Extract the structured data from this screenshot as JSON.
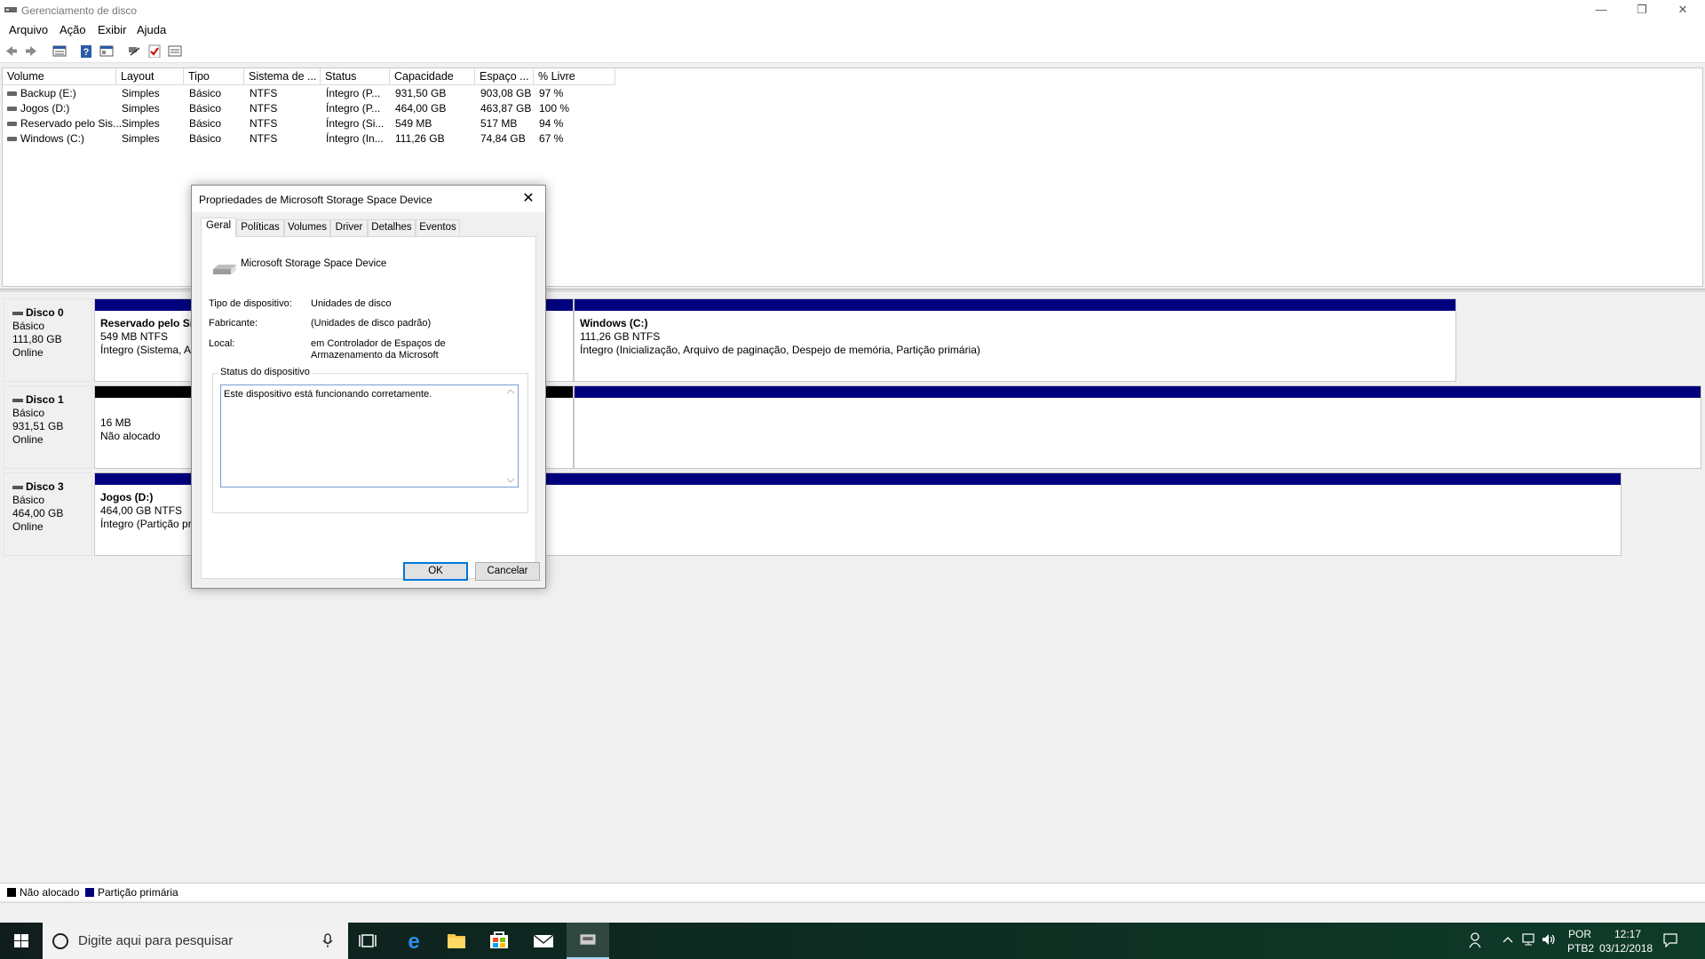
{
  "window": {
    "title": "Gerenciamento de disco",
    "minimize": "—",
    "restore": "❐",
    "close": "✕"
  },
  "menu": [
    "Arquivo",
    "Ação",
    "Exibir",
    "Ajuda"
  ],
  "toolbar_icons": [
    "back-icon",
    "forward-icon",
    "volume-list-icon",
    "help-icon",
    "properties-icon",
    "connect-icon",
    "check-icon",
    "details-icon"
  ],
  "volume_list": {
    "columns": [
      "Volume",
      "Layout",
      "Tipo",
      "Sistema de ...",
      "Status",
      "Capacidade",
      "Espaço ...",
      "% Livre"
    ],
    "rows": [
      [
        "Backup (E:)",
        "Simples",
        "Básico",
        "NTFS",
        "Íntegro (P...",
        "931,50 GB",
        "903,08 GB",
        "97 %"
      ],
      [
        "Jogos (D:)",
        "Simples",
        "Básico",
        "NTFS",
        "Íntegro (P...",
        "464,00 GB",
        "463,87 GB",
        "100 %"
      ],
      [
        "Reservado pelo Sis...",
        "Simples",
        "Básico",
        "NTFS",
        "Íntegro (Si...",
        "549 MB",
        "517 MB",
        "94 %"
      ],
      [
        "Windows (C:)",
        "Simples",
        "Básico",
        "NTFS",
        "Íntegro (In...",
        "111,26 GB",
        "74,84 GB",
        "67 %"
      ]
    ]
  },
  "disks": [
    {
      "name": "Disco 0",
      "type": "Básico",
      "size": "111,80 GB",
      "state": "Online",
      "parts": [
        {
          "title": "Reservado pelo Sis",
          "line2": "549 MB NTFS",
          "line3": "Íntegro (Sistema, At"
        },
        {
          "title": "Windows  (C:)",
          "line2": "111,26 GB NTFS",
          "line3": "Íntegro (Inicialização, Arquivo de paginação, Despejo de memória, Partição primária)"
        }
      ]
    },
    {
      "name": "Disco 1",
      "type": "Básico",
      "size": "931,51 GB",
      "state": "Online",
      "parts": [
        {
          "title": "",
          "line2": "16 MB",
          "line3": "Não alocado"
        }
      ]
    },
    {
      "name": "Disco 3",
      "type": "Básico",
      "size": "464,00 GB",
      "state": "Online",
      "parts": [
        {
          "title": "Jogos  (D:)",
          "line2": "464,00 GB NTFS",
          "line3": "Íntegro (Partição pr"
        }
      ]
    }
  ],
  "legend": {
    "unallocated": "Não alocado",
    "primary": "Partição primária"
  },
  "colors": {
    "unallocated": "#000000",
    "primary": "#00007f",
    "focus": "#0078d7"
  },
  "dialog": {
    "title": "Propriedades de Microsoft Storage Space Device",
    "tabs": [
      "Geral",
      "Políticas",
      "Volumes",
      "Driver",
      "Detalhes",
      "Eventos"
    ],
    "active_tab": "Geral",
    "device_name": "Microsoft Storage Space Device",
    "fields": [
      {
        "label": "Tipo de dispositivo:",
        "value": "Unidades de disco"
      },
      {
        "label": "Fabricante:",
        "value": "(Unidades de disco padrão)"
      },
      {
        "label": "Local:",
        "value": "em Controlador de Espaços de",
        "value2": "Armazenamento da Microsoft"
      }
    ],
    "status_group": "Status do dispositivo",
    "status_text": "Este dispositivo está funcionando corretamente.",
    "ok": "OK",
    "cancel": "Cancelar"
  },
  "taskbar": {
    "search_placeholder": "Digite aqui para pesquisar",
    "lang1": "POR",
    "lang2": "PTB2",
    "time": "12:17",
    "date": "03/12/2018"
  }
}
